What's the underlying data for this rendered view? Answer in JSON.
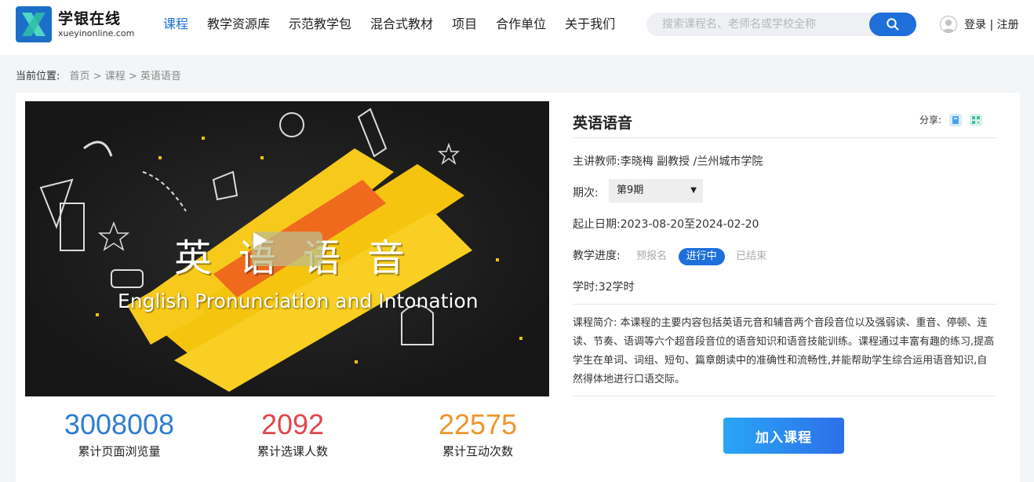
{
  "brand": {
    "title": "学银在线",
    "subtitle": "xueyinonline.com"
  },
  "nav": {
    "items": [
      {
        "label": "课程",
        "active": true
      },
      {
        "label": "教学资源库",
        "active": false
      },
      {
        "label": "示范教学包",
        "active": false
      },
      {
        "label": "混合式教材",
        "active": false
      },
      {
        "label": "项目",
        "active": false
      },
      {
        "label": "合作单位",
        "active": false
      },
      {
        "label": "关于我们",
        "active": false
      }
    ]
  },
  "search": {
    "placeholder": "搜索课程名、老师名或学校全称",
    "icon": "search-icon"
  },
  "user": {
    "icon": "user-avatar-icon",
    "links": "登录 | 注册"
  },
  "breadcrumb": {
    "label": "当前位置:",
    "path": "首页 > 课程 > 英语语音"
  },
  "video": {
    "title_cn": "英语语音",
    "title_en": "English Pronunciation and Intonation",
    "play_icon": "play-icon"
  },
  "stats": [
    {
      "value": "3008008",
      "label": "累计页面浏览量",
      "color": "#2f7dd1"
    },
    {
      "value": "2092",
      "label": "累计选课人数",
      "color": "#e0474c"
    },
    {
      "value": "22575",
      "label": "累计互动次数",
      "color": "#f0952c"
    }
  ],
  "course": {
    "title": "英语语音",
    "share_label": "分享:",
    "teacher": "主讲教师:李晓梅 副教授 /兰州城市学院",
    "term_label": "期次:",
    "term_value": "第9期",
    "dates": "起止日期:2023-08-20至2024-02-20",
    "progress_label": "教学进度:",
    "progress_steps": [
      "预报名",
      "进行中",
      "已结束"
    ],
    "progress_active": "进行中",
    "hours": "学时:32学时",
    "description": "课程简介: 本课程的主要内容包括英语元音和辅音两个音段音位以及强弱读、重音、停顿、连读、节奏、语调等六个超音段音位的语音知识和语音技能训练。课程通过丰富有趣的练习,提高学生在单词、词组、短句、篇章朗读中的准确性和流畅性,并能帮助学生综合运用语音知识,自然得体地进行口语交际。",
    "join_label": "加入课程"
  },
  "colors": {
    "accent": "#1e6fd9",
    "background": "#f3f5f7"
  }
}
